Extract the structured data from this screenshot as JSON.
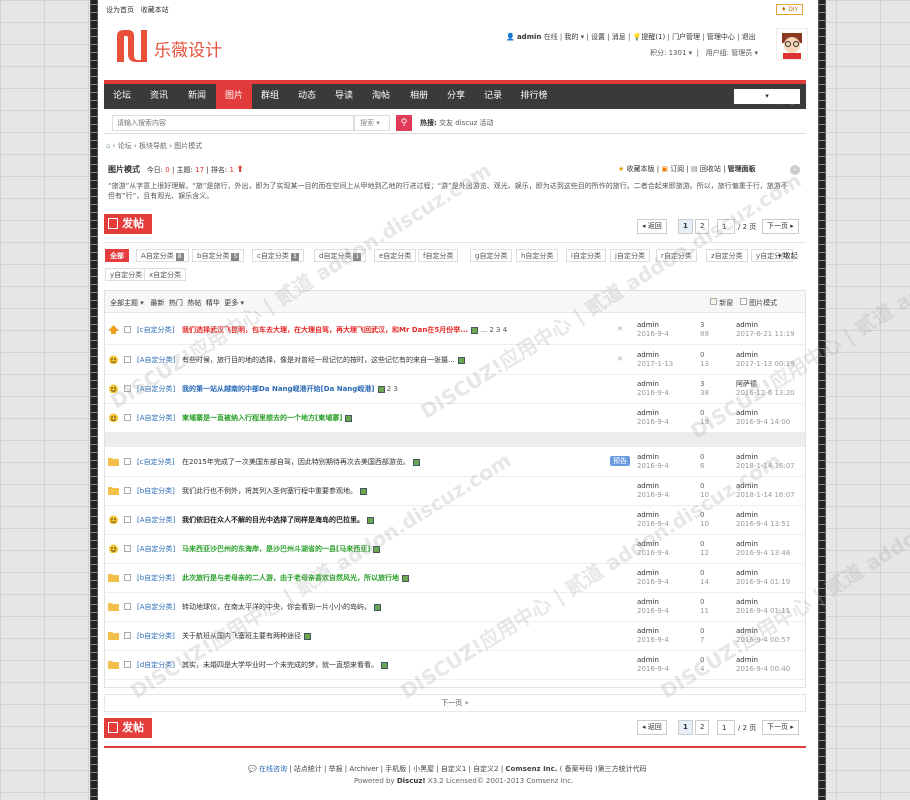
{
  "topbar": {
    "links": [
      "设为首页",
      "收藏本站"
    ],
    "diy": "DIY"
  },
  "logo": {
    "mark": "N",
    "text": "乐薇设计"
  },
  "user": {
    "name": "admin",
    "status": "在线",
    "links": [
      "我的",
      "设置",
      "消息",
      "提醒(1)",
      "门户管理",
      "管理中心",
      "退出"
    ],
    "points": "积分: 1301",
    "group": "用户组: 管理员"
  },
  "nav": {
    "items": [
      "论坛",
      "资讯",
      "新闻",
      "图片",
      "群组",
      "动态",
      "导读",
      "淘帖",
      "相册",
      "分享",
      "记录",
      "排行榜"
    ],
    "active": "图片",
    "quick": "快捷导航"
  },
  "search": {
    "placeholder": "请输入搜索内容",
    "type": "搜索",
    "hot_label": "热搜:",
    "hot": [
      "交友",
      "discuz",
      "活动"
    ]
  },
  "breadcrumb": [
    "论坛",
    "板块导航",
    "图片模式"
  ],
  "forum": {
    "title": "图片模式",
    "today_label": "今日:",
    "today": "0",
    "topics_label": "主题:",
    "topics": "17",
    "rank_label": "排名:",
    "rank": "1",
    "fav": "收藏本版",
    "rss": "订阅",
    "recycle": "回收站",
    "admin": "管理面板",
    "desc": "“旅游”从字意上很好理解。“旅”是旅行，外出，即为了实现某一目的而在空间上从甲地到乙地的行进过程；“游”是外出游览、观光、娱乐，即为达到这些目的所作的旅行。二者合起来即旅游。所以，旅行偏重于行，旅游不但有“行”，且有观光、娱乐含义。"
  },
  "post_button": "发帖",
  "pager": {
    "back": "返回",
    "p1": "1",
    "p2": "2",
    "input": "1",
    "total": "/ 2 页",
    "next": "下一页"
  },
  "categories": {
    "all": "全部",
    "items": [
      [
        "A自定分类",
        "8"
      ],
      [
        "b自定分类",
        "5"
      ],
      [
        "c自定分类",
        "3"
      ],
      [
        "d自定分类",
        "1"
      ],
      [
        "e自定分类",
        ""
      ],
      [
        "f自定分类",
        ""
      ],
      [
        "g自定分类",
        ""
      ],
      [
        "h自定分类",
        ""
      ],
      [
        "i自定分类",
        ""
      ],
      [
        "j自定分类",
        ""
      ],
      [
        "r自定分类",
        ""
      ],
      [
        "z自定分类",
        ""
      ],
      [
        "y自定分类",
        ""
      ],
      [
        "k自定分类",
        ""
      ]
    ],
    "collapse": "收起",
    "row2": [
      "y自定分类",
      "x自定分类"
    ]
  },
  "filters": {
    "all": "全部主题",
    "items": [
      "最新",
      "热门",
      "热帖",
      "精华",
      "更多"
    ],
    "newwin": "新窗",
    "picmode": "图片模式"
  },
  "threads": [
    {
      "tag": "[c自定分类]",
      "title": "我们选择武汉飞昆明，包车去大理，在大理自驾，再大理飞回武汉，和Mr Dan在5月份举...",
      "pages": "... 2  3  4",
      "author": "admin",
      "adate": "2016-9-4",
      "reply": "3",
      "views": "88",
      "last": "admin",
      "ldate": "2017-6-21 11:19",
      "color": "red",
      "icon": "up"
    },
    {
      "tag": "[A自定分类]",
      "title": "有些时候，旅行目的地的选择，像是对曾经一段记忆的按时，这些记忆有的来自一张摄...",
      "pages": "",
      "author": "admin",
      "adate": "2017-1-13",
      "reply": "0",
      "views": "13",
      "last": "admin",
      "ldate": "2017-1-13 00:19",
      "color": "",
      "icon": "face"
    },
    {
      "tag": "[A自定分类]",
      "title": "我的第一站从越南的中部Da Nang岘港开始[Da Nang岘港]",
      "pages": "2  3",
      "author": "admin",
      "adate": "2016-9-4",
      "reply": "3",
      "views": "38",
      "last": "阿萨德",
      "ldate": "2016-12-6 13:20",
      "color": "blue",
      "icon": "face"
    },
    {
      "tag": "[A自定分类]",
      "title": "柬埔寨是一直被纳入行程里想去的一个地方[柬埔寨]",
      "pages": "",
      "author": "admin",
      "adate": "2016-9-4",
      "reply": "0",
      "views": "19",
      "last": "admin",
      "ldate": "2016-9-4 14:00",
      "color": "green",
      "icon": "face"
    },
    {
      "tag": "[c自定分类]",
      "title": "在2015年完成了一次美国东部自驾，因此特别期待再次去美国西部游览。",
      "pages": "",
      "author": "admin",
      "adate": "2016-9-4",
      "reply": "0",
      "views": "6",
      "last": "admin",
      "ldate": "2018-1-14 16:07",
      "color": "",
      "icon": "folder",
      "badge": "预告"
    },
    {
      "tag": "[b自定分类]",
      "title": "我们此行也不例外，将其列入圣何塞行程中重要参观地。",
      "pages": "",
      "author": "admin",
      "adate": "2016-9-4",
      "reply": "0",
      "views": "10",
      "last": "admin",
      "ldate": "2018-1-14 16:07",
      "color": "",
      "icon": "folder"
    },
    {
      "tag": "[A自定分类]",
      "title": "我们依旧在众人不解的目光中选择了同样是海岛的巴拉里。",
      "pages": "",
      "author": "admin",
      "adate": "2016-9-4",
      "reply": "0",
      "views": "10",
      "last": "admin",
      "ldate": "2016-9-4 13:51",
      "color": "bold",
      "icon": "face"
    },
    {
      "tag": "[A自定分类]",
      "title": "马来西亚沙巴州的东海岸，是沙巴州斗湖省的一县[马来西亚]",
      "pages": "",
      "author": "admin",
      "adate": "2016-9-4",
      "reply": "0",
      "views": "12",
      "last": "admin",
      "ldate": "2016-9-4 13:48",
      "color": "green",
      "icon": "face"
    },
    {
      "tag": "[b自定分类]",
      "title": "此次旅行是与老母亲的二人游，由于老母亲喜欢自然风光，所以旅行地",
      "pages": "",
      "author": "admin",
      "adate": "2016-9-4",
      "reply": "0",
      "views": "14",
      "last": "admin",
      "ldate": "2016-9-4 01:19",
      "color": "green",
      "icon": "folder"
    },
    {
      "tag": "[A自定分类]",
      "title": "转动地球仪，在南太平洋的中央，你会看到一片小小的岛屿，",
      "pages": "",
      "author": "admin",
      "adate": "2016-9-4",
      "reply": "0",
      "views": "11",
      "last": "admin",
      "ldate": "2016-9-4 01:11",
      "color": "",
      "icon": "folder"
    },
    {
      "tag": "[b自定分类]",
      "title": "关于航班从国内飞塞班主要有两种途径",
      "pages": "",
      "author": "admin",
      "adate": "2016-9-4",
      "reply": "0",
      "views": "7",
      "last": "admin",
      "ldate": "2016-9-4 00:57",
      "color": "",
      "icon": "folder"
    },
    {
      "tag": "[d自定分类]",
      "title": "其实，未婚四是大学毕业时一个未完成的梦，就一直想来看看。",
      "pages": "",
      "author": "admin",
      "adate": "2016-9-4",
      "reply": "0",
      "views": "4",
      "last": "admin",
      "ldate": "2016-9-4 00:40",
      "color": "",
      "icon": "folder"
    }
  ],
  "nextpage": "下一页 »",
  "footer": {
    "online": "在线咨询",
    "links": "站点统计 | 举报 | Archiver | 手机版 | 小黑屋 | 自定义1 | 自定义2 |",
    "company": "Comsenz Inc.",
    "rest": "( 备案号码 )第三方统计代码",
    "powered": "Powered by",
    "discuz": "Discuz!",
    "license": "X3.2 Licensed© 2001-2013 Comsenz Inc."
  },
  "watermark": "DISCUZ!应用中心 | 贰道 addon.discuz.com"
}
